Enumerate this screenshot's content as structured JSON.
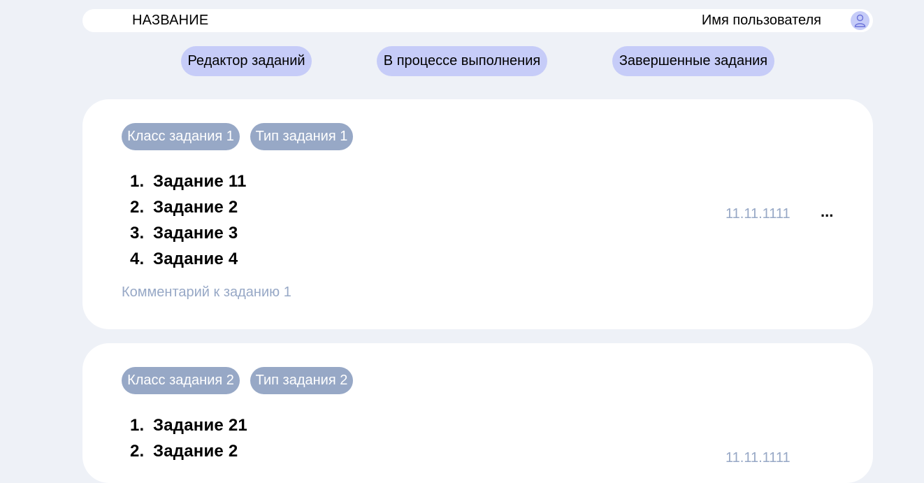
{
  "header": {
    "title": "НАЗВАНИЕ",
    "user_name": "Имя пользователя",
    "avatar_icon": "user-icon"
  },
  "nav": {
    "tabs": [
      {
        "label": "Редактор заданий"
      },
      {
        "label": "В процессе выполнения"
      },
      {
        "label": "Завершенные задания"
      }
    ]
  },
  "cards": [
    {
      "class_tag": "Класс задания 1",
      "type_tag": "Тип задания 1",
      "tasks": [
        {
          "num": "1.",
          "label": "Задание 11"
        },
        {
          "num": "2.",
          "label": "Задание 2"
        },
        {
          "num": "3.",
          "label": "Задание 3"
        },
        {
          "num": "4.",
          "label": "Задание 4"
        }
      ],
      "comment": "Комментарий к заданию 1",
      "date": "11.11.1111",
      "more": "..."
    },
    {
      "class_tag": "Класс задания 2",
      "type_tag": "Тип задания 2",
      "tasks": [
        {
          "num": "1.",
          "label": "Задание 21"
        },
        {
          "num": "2.",
          "label": "Задание 2"
        }
      ],
      "date": "11.11.1111"
    }
  ],
  "colors": {
    "background": "#eef1f7",
    "accent": "#c6ccf8",
    "tag": "#97a8c6",
    "muted_text": "#97a8c6"
  }
}
